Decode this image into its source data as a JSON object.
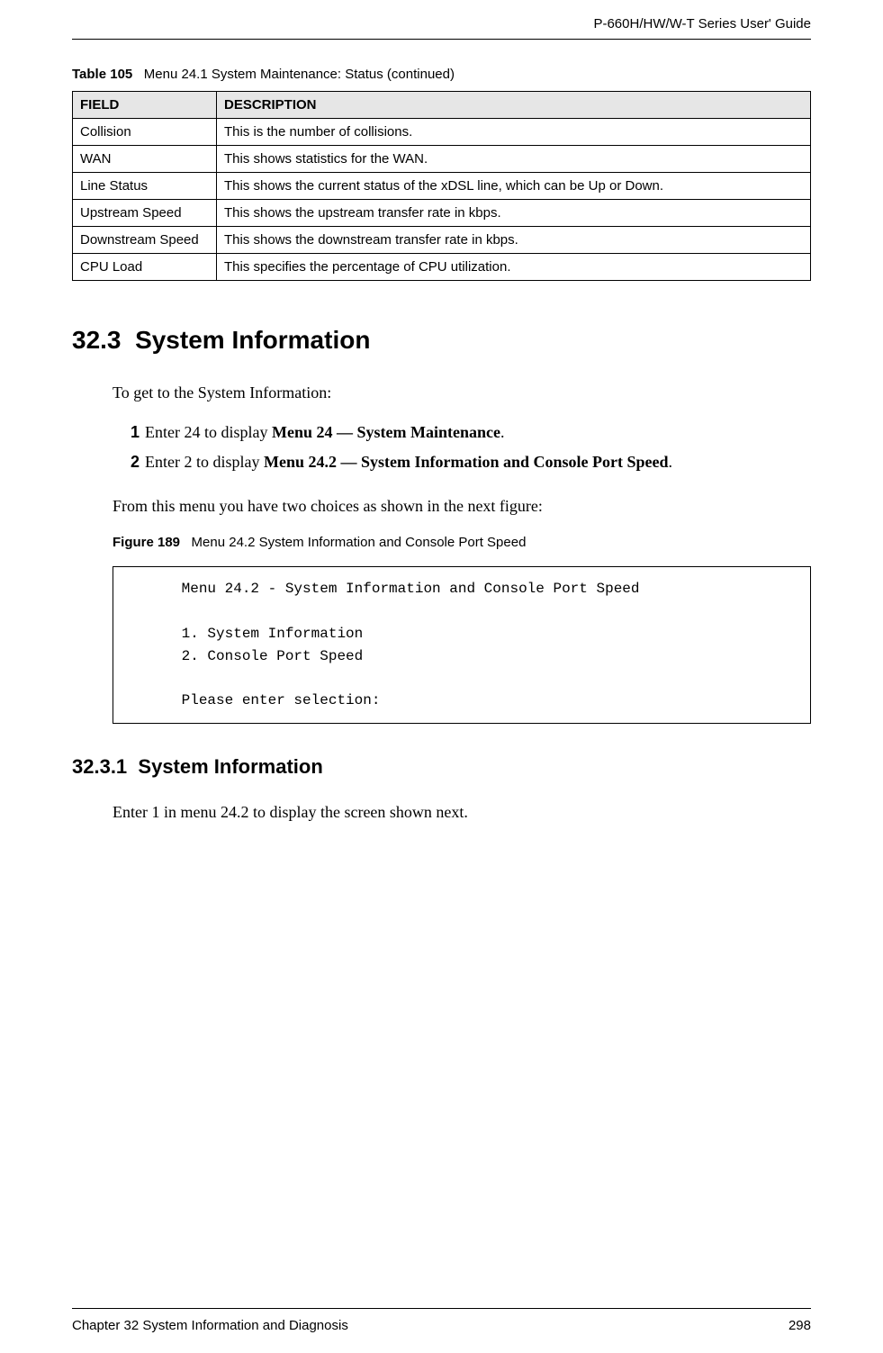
{
  "header": {
    "guide_title": "P-660H/HW/W-T Series User' Guide"
  },
  "table": {
    "label": "Table 105",
    "caption": "Menu 24.1 System Maintenance: Status (continued)",
    "columns": {
      "field": "FIELD",
      "description": "DESCRIPTION"
    },
    "rows": [
      {
        "field": "Collision",
        "indent": true,
        "description": "This is the number of collisions."
      },
      {
        "field": "WAN",
        "indent": false,
        "description": "This shows statistics for the WAN."
      },
      {
        "field": "Line Status",
        "indent": true,
        "description": "This shows the current status of the xDSL line, which can be Up or Down."
      },
      {
        "field": "Upstream Speed",
        "indent": true,
        "description": "This shows the upstream transfer rate in kbps."
      },
      {
        "field": "Downstream Speed",
        "indent": true,
        "description": "This shows the downstream transfer rate in kbps."
      },
      {
        "field": "CPU Load",
        "indent": false,
        "description": "This specifies the percentage of CPU utilization."
      }
    ]
  },
  "section": {
    "number": "32.3",
    "title": "System Information",
    "intro": "To get to the System Information:",
    "steps": [
      {
        "num": "1",
        "text_before": "Enter 24 to display ",
        "bold": "Menu 24 — System Maintenance",
        "text_after": "."
      },
      {
        "num": "2",
        "text_before": "Enter 2 to display ",
        "bold": "Menu 24.2 — System Information and Console Port Speed",
        "text_after": "."
      }
    ],
    "after_steps": "From this menu you have two choices as shown in the next figure:"
  },
  "figure": {
    "label": "Figure 189",
    "caption": "Menu 24.2 System Information and Console Port Speed",
    "content": "      Menu 24.2 - System Information and Console Port Speed\n\n      1. System Information\n      2. Console Port Speed\n\n      Please enter selection:"
  },
  "subsection": {
    "number": "32.3.1",
    "title": "System Information",
    "body": "Enter 1 in menu 24.2 to display the screen shown next."
  },
  "footer": {
    "chapter": "Chapter 32 System Information and Diagnosis",
    "page": "298"
  }
}
